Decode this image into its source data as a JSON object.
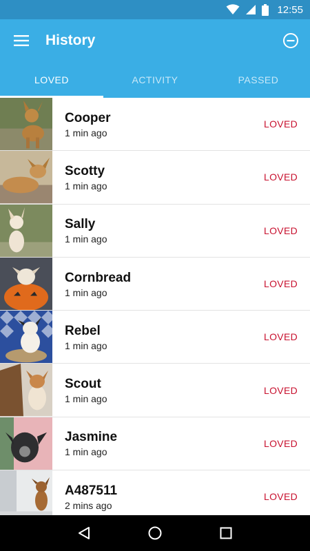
{
  "status_bar": {
    "time": "12:55",
    "icons": [
      "wifi-icon",
      "signal-icon",
      "battery-icon"
    ]
  },
  "app_bar": {
    "title": "History",
    "menu_icon": "hamburger-menu-icon",
    "action_icon": "remove-circle-icon"
  },
  "tabs": [
    {
      "label": "LOVED",
      "active": true
    },
    {
      "label": "ACTIVITY",
      "active": false
    },
    {
      "label": "PASSED",
      "active": false
    }
  ],
  "items": [
    {
      "name": "Cooper",
      "time": "1 min ago",
      "status": "LOVED"
    },
    {
      "name": "Scotty",
      "time": "1 min ago",
      "status": "LOVED"
    },
    {
      "name": "Sally",
      "time": "1 min ago",
      "status": "LOVED"
    },
    {
      "name": "Cornbread",
      "time": "1 min ago",
      "status": "LOVED"
    },
    {
      "name": "Rebel",
      "time": "1 min ago",
      "status": "LOVED"
    },
    {
      "name": "Scout",
      "time": "1 min ago",
      "status": "LOVED"
    },
    {
      "name": "Jasmine",
      "time": "1 min ago",
      "status": "LOVED"
    },
    {
      "name": "A487511",
      "time": "2 mins ago",
      "status": "LOVED"
    }
  ],
  "nav_bar": {
    "icons": [
      "back-icon",
      "home-icon",
      "recents-icon"
    ]
  },
  "colors": {
    "primary": "#3aaee5",
    "status_bar": "#2e8fc4",
    "loved": "#c8102e"
  }
}
